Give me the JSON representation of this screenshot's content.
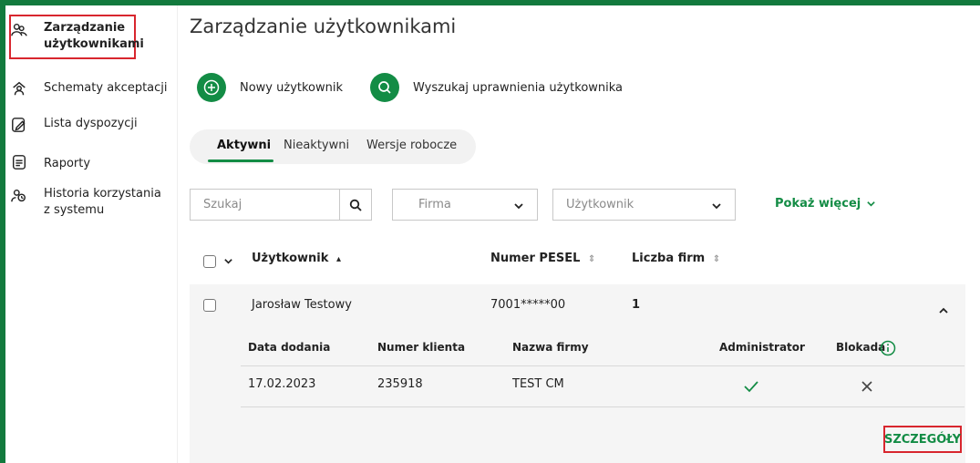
{
  "sidebar": {
    "items": [
      {
        "label": "Zarządzanie użytkownikami",
        "icon": "users-admin-icon",
        "active": true
      },
      {
        "label": "Schematy akceptacji",
        "icon": "approval-scheme-icon"
      },
      {
        "label": "Lista dyspozycji",
        "icon": "edit-document-icon"
      },
      {
        "label": "Raporty",
        "icon": "report-icon"
      },
      {
        "label": "Historia korzystania z systemu",
        "icon": "user-history-icon"
      }
    ]
  },
  "page": {
    "title": "Zarządzanie użytkownikami"
  },
  "actions": {
    "new_user": {
      "label": "Nowy użytkownik",
      "icon": "plus-circle-icon"
    },
    "search_permissions": {
      "label": "Wyszukaj uprawnienia użytkownika",
      "icon": "search-icon"
    }
  },
  "tabs": [
    {
      "label": "Aktywni",
      "active": true
    },
    {
      "label": "Nieaktywni"
    },
    {
      "label": "Wersje robocze"
    }
  ],
  "filters": {
    "search_placeholder": "Szukaj",
    "company_placeholder": "Firma",
    "user_placeholder": "Użytkownik",
    "show_more": "Pokaż więcej"
  },
  "table": {
    "columns": [
      "Użytkownik",
      "Numer PESEL",
      "Liczba firm"
    ],
    "rows": [
      {
        "user": "Jarosław Testowy",
        "pesel": "7001*****00",
        "companies": "1",
        "expanded": true,
        "details": {
          "columns": [
            "Data dodania",
            "Numer klienta",
            "Nazwa firmy",
            "Administrator",
            "Blokada"
          ],
          "rows": [
            {
              "date": "17.02.2023",
              "client_number": "235918",
              "company": "TEST CM",
              "admin": "check-icon",
              "blocked": "x-icon"
            }
          ],
          "button": "SZCZEGÓŁY"
        }
      }
    ]
  },
  "colors": {
    "accent": "#138c45",
    "highlight": "#d8262e"
  }
}
